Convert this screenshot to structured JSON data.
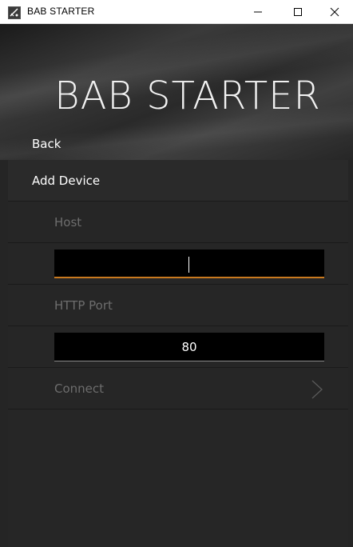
{
  "window": {
    "title": "BAB STARTER",
    "controls": {
      "minimize": "—",
      "maximize": "☐",
      "close": "✕"
    }
  },
  "header": {
    "app_title": "BAB STARTER",
    "back_label": "Back"
  },
  "section": {
    "title": "Add Device"
  },
  "form": {
    "host": {
      "label": "Host",
      "value": ""
    },
    "port": {
      "label": "HTTP Port",
      "value": "80"
    },
    "connect_label": "Connect"
  },
  "colors": {
    "accent": "#c8791e",
    "background": "#252525",
    "muted_text": "#6d6d6d"
  },
  "icons": {
    "app": "app-icon",
    "chevron": "chevron-right-icon"
  }
}
